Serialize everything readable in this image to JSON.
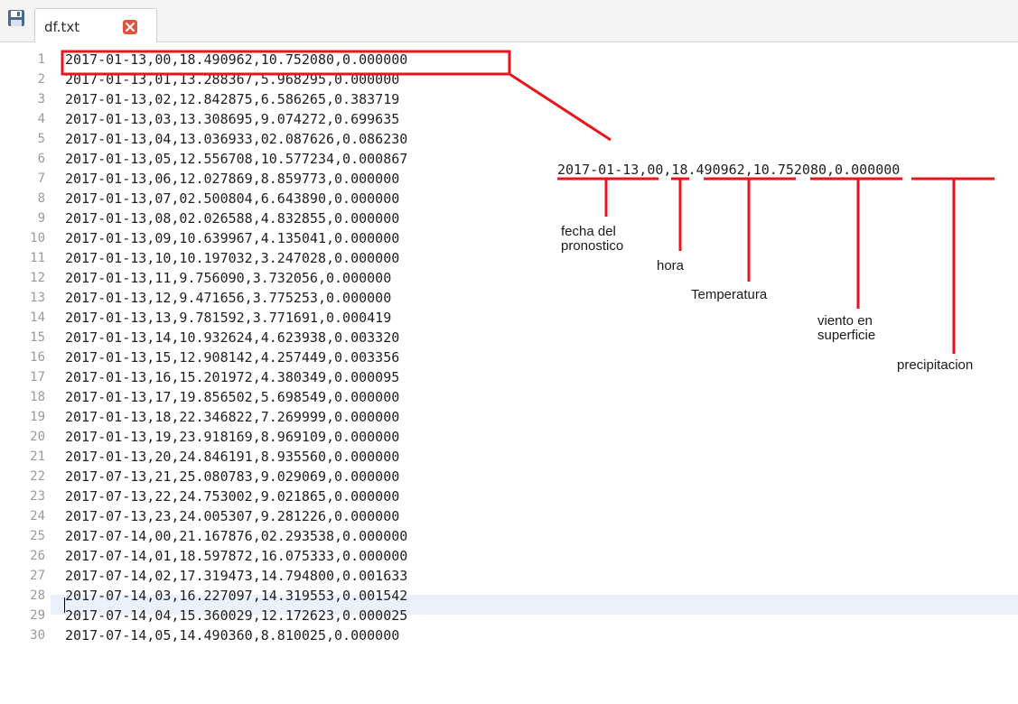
{
  "tab": {
    "title": "df.txt",
    "close_icon": "close-icon",
    "save_icon": "save-icon"
  },
  "lines": [
    {
      "num": "1",
      "text": "2017-01-13,00,18.490962,10.752080,0.000000"
    },
    {
      "num": "2",
      "text": "2017-01-13,01,13.288367,5.968295,0.000000"
    },
    {
      "num": "3",
      "text": "2017-01-13,02,12.842875,6.586265,0.383719"
    },
    {
      "num": "4",
      "text": "2017-01-13,03,13.308695,9.074272,0.699635"
    },
    {
      "num": "5",
      "text": "2017-01-13,04,13.036933,02.087626,0.086230"
    },
    {
      "num": "6",
      "text": "2017-01-13,05,12.556708,10.577234,0.000867"
    },
    {
      "num": "7",
      "text": "2017-01-13,06,12.027869,8.859773,0.000000"
    },
    {
      "num": "8",
      "text": "2017-01-13,07,02.500804,6.643890,0.000000"
    },
    {
      "num": "9",
      "text": "2017-01-13,08,02.026588,4.832855,0.000000"
    },
    {
      "num": "10",
      "text": "2017-01-13,09,10.639967,4.135041,0.000000"
    },
    {
      "num": "11",
      "text": "2017-01-13,10,10.197032,3.247028,0.000000"
    },
    {
      "num": "12",
      "text": "2017-01-13,11,9.756090,3.732056,0.000000"
    },
    {
      "num": "13",
      "text": "2017-01-13,12,9.471656,3.775253,0.000000"
    },
    {
      "num": "14",
      "text": "2017-01-13,13,9.781592,3.771691,0.000419"
    },
    {
      "num": "15",
      "text": "2017-01-13,14,10.932624,4.623938,0.003320"
    },
    {
      "num": "16",
      "text": "2017-01-13,15,12.908142,4.257449,0.003356"
    },
    {
      "num": "17",
      "text": "2017-01-13,16,15.201972,4.380349,0.000095"
    },
    {
      "num": "18",
      "text": "2017-01-13,17,19.856502,5.698549,0.000000"
    },
    {
      "num": "19",
      "text": "2017-01-13,18,22.346822,7.269999,0.000000"
    },
    {
      "num": "20",
      "text": "2017-01-13,19,23.918169,8.969109,0.000000"
    },
    {
      "num": "21",
      "text": "2017-01-13,20,24.846191,8.935560,0.000000"
    },
    {
      "num": "22",
      "text": "2017-07-13,21,25.080783,9.029069,0.000000"
    },
    {
      "num": "23",
      "text": "2017-07-13,22,24.753002,9.021865,0.000000"
    },
    {
      "num": "24",
      "text": "2017-07-13,23,24.005307,9.281226,0.000000"
    },
    {
      "num": "25",
      "text": "2017-07-14,00,21.167876,02.293538,0.000000"
    },
    {
      "num": "26",
      "text": "2017-07-14,01,18.597872,16.075333,0.000000"
    },
    {
      "num": "27",
      "text": "2017-07-14,02,17.319473,14.794800,0.001633"
    },
    {
      "num": "28",
      "text": "2017-07-14,03,16.227097,14.319553,0.001542"
    },
    {
      "num": "29",
      "text": "2017-07-14,04,15.360029,12.172623,0.000025"
    },
    {
      "num": "30",
      "text": "2017-07-14,05,14.490360,8.810025,0.000000"
    }
  ],
  "annotation": {
    "sample": "2017-01-13,00,18.490962,10.752080,0.000000",
    "labels": {
      "fecha_line1": "fecha del",
      "fecha_line2": "pronostico",
      "hora": "hora",
      "temperatura": "Temperatura",
      "viento_line1": "viento en",
      "viento_line2": "superficie",
      "precipitacion": "precipitacion"
    },
    "highlight_color": "#e8161c"
  }
}
